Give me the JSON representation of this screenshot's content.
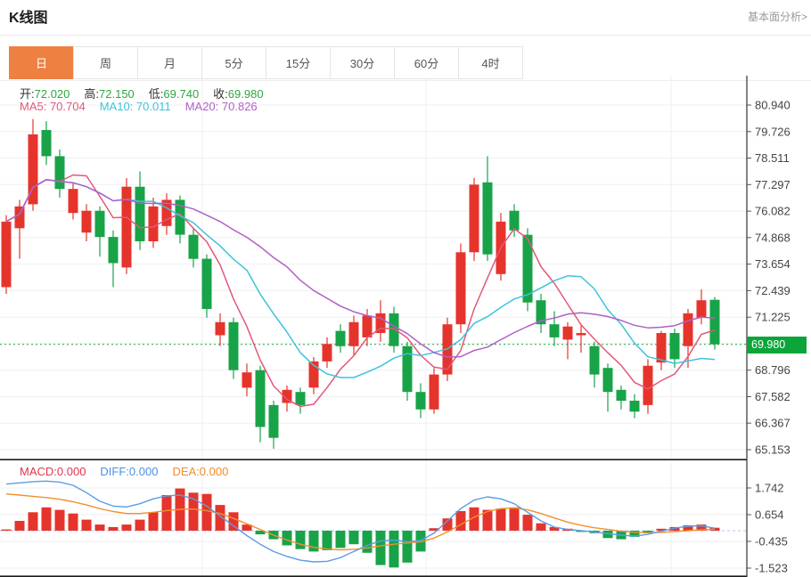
{
  "header": {
    "title": "K线图",
    "link_label": "基本面分析>"
  },
  "tabs": {
    "items": [
      "日",
      "周",
      "月",
      "5分",
      "15分",
      "30分",
      "60分",
      "4时"
    ],
    "selected": "日"
  },
  "ohlc": {
    "open_label": "开:",
    "open": "72.020",
    "high_label": "高:",
    "high": "72.150",
    "low_label": "低:",
    "low": "69.740",
    "close_label": "收:",
    "close": "69.980"
  },
  "ma": {
    "ma5": "MA5: 70.704",
    "ma10": "MA10: 70.011",
    "ma20": "MA20: 70.826"
  },
  "macd_labels": {
    "macd": "MACD:0.000",
    "diff": "DIFF:0.000",
    "dea": "DEA:0.000"
  },
  "colors": {
    "up": "#e5342c",
    "down": "#18a348",
    "ma5": "#e25878",
    "ma10": "#3ec3dc",
    "ma20": "#b05fc8",
    "diff": "#5c9ce6",
    "dea": "#f0912c",
    "accent_tab": "#ee8142",
    "badge_green": "#0ca53a",
    "value_green": "#2ba83e",
    "axis_text": "#444444",
    "grid": "#efefef",
    "current_line": "#1fa83c"
  },
  "chart_data": {
    "type": "candlestick+macd",
    "title": "K线图",
    "price_axis": {
      "ticks": [
        80.94,
        79.726,
        78.511,
        77.297,
        76.082,
        74.868,
        73.654,
        72.439,
        71.225,
        70.011,
        68.796,
        67.582,
        66.367,
        65.153
      ],
      "tick_labels": [
        "80.940",
        "79.726",
        "78.511",
        "77.297",
        "76.082",
        "74.868",
        "73.654",
        "72.439",
        "71.225",
        "70.011",
        "68.796",
        "67.582",
        "66.367",
        "65.153"
      ],
      "hidden_tick_index": 9,
      "current_price": 69.98,
      "current_price_label": "69.980"
    },
    "candles_format": [
      "open",
      "high",
      "low",
      "close"
    ],
    "candles": [
      [
        72.6,
        75.9,
        72.3,
        75.6
      ],
      [
        75.3,
        76.6,
        73.9,
        76.3
      ],
      [
        76.4,
        80.3,
        76.1,
        79.6
      ],
      [
        79.8,
        80.2,
        78.2,
        78.6
      ],
      [
        78.6,
        78.9,
        76.7,
        77.1
      ],
      [
        76.0,
        77.4,
        75.7,
        77.1
      ],
      [
        75.1,
        76.4,
        74.7,
        76.1
      ],
      [
        76.1,
        76.3,
        74.0,
        74.9
      ],
      [
        74.9,
        75.2,
        72.6,
        73.7
      ],
      [
        73.5,
        77.6,
        73.2,
        77.2
      ],
      [
        77.2,
        77.9,
        74.3,
        74.7
      ],
      [
        74.7,
        76.7,
        74.4,
        76.3
      ],
      [
        75.4,
        76.9,
        75.0,
        76.6
      ],
      [
        76.6,
        76.8,
        74.6,
        75.0
      ],
      [
        75.0,
        75.3,
        73.5,
        73.9
      ],
      [
        73.9,
        74.1,
        71.2,
        71.6
      ],
      [
        70.4,
        71.4,
        69.9,
        71.0
      ],
      [
        71.0,
        71.2,
        68.4,
        68.8
      ],
      [
        68.0,
        69.1,
        67.6,
        68.7
      ],
      [
        68.8,
        69.0,
        65.5,
        66.2
      ],
      [
        67.2,
        67.4,
        65.2,
        65.7
      ],
      [
        67.3,
        68.1,
        66.9,
        67.9
      ],
      [
        67.8,
        68.0,
        66.8,
        67.2
      ],
      [
        68.0,
        69.4,
        67.7,
        69.2
      ],
      [
        69.2,
        70.3,
        68.9,
        70.0
      ],
      [
        70.6,
        70.9,
        69.6,
        69.9
      ],
      [
        69.9,
        71.3,
        69.5,
        71.0
      ],
      [
        70.3,
        71.6,
        69.9,
        71.3
      ],
      [
        70.5,
        72.0,
        70.1,
        71.4
      ],
      [
        71.4,
        71.7,
        69.6,
        69.9
      ],
      [
        69.9,
        70.1,
        67.4,
        67.8
      ],
      [
        67.8,
        68.2,
        66.6,
        67.0
      ],
      [
        67.0,
        68.9,
        66.8,
        68.6
      ],
      [
        68.6,
        71.2,
        68.3,
        70.9
      ],
      [
        70.9,
        74.6,
        70.5,
        74.2
      ],
      [
        74.2,
        77.6,
        73.8,
        77.3
      ],
      [
        77.4,
        78.6,
        73.8,
        74.1
      ],
      [
        73.2,
        76.0,
        72.9,
        75.6
      ],
      [
        76.1,
        76.4,
        74.9,
        75.2
      ],
      [
        75.0,
        75.3,
        71.5,
        71.9
      ],
      [
        72.0,
        72.3,
        70.5,
        70.9
      ],
      [
        70.9,
        71.5,
        69.9,
        70.3
      ],
      [
        70.2,
        71.0,
        69.3,
        70.8
      ],
      [
        70.4,
        70.9,
        69.6,
        70.5
      ],
      [
        69.9,
        70.1,
        68.0,
        68.6
      ],
      [
        68.9,
        69.1,
        66.9,
        67.8
      ],
      [
        67.9,
        68.1,
        67.0,
        67.4
      ],
      [
        67.4,
        67.7,
        66.6,
        66.9
      ],
      [
        67.2,
        69.3,
        66.8,
        69.0
      ],
      [
        69.15,
        70.6,
        68.8,
        70.5
      ],
      [
        70.5,
        70.7,
        68.9,
        69.3
      ],
      [
        69.9,
        71.6,
        68.9,
        71.4
      ],
      [
        71.2,
        72.5,
        70.9,
        72.0
      ],
      [
        72.02,
        72.15,
        69.74,
        69.98
      ]
    ],
    "ma_periods": [
      5,
      10,
      20
    ],
    "macd": {
      "ticks": [
        1.742,
        0.654,
        -0.435,
        -1.523
      ],
      "tick_labels": [
        "1.742",
        "0.654",
        "-0.435",
        "-1.523"
      ],
      "hist": [
        0.05,
        0.4,
        0.75,
        0.95,
        0.85,
        0.7,
        0.45,
        0.25,
        0.15,
        0.25,
        0.45,
        0.75,
        1.45,
        1.72,
        1.55,
        1.5,
        1.05,
        0.75,
        0.25,
        -0.15,
        -0.35,
        -0.6,
        -0.75,
        -0.85,
        -0.8,
        -0.7,
        -0.55,
        -0.9,
        -1.4,
        -1.5,
        -1.3,
        -0.85,
        0.1,
        0.5,
        0.8,
        0.95,
        0.85,
        0.9,
        0.95,
        0.65,
        0.3,
        0.15,
        0.08,
        -0.05,
        -0.1,
        -0.3,
        -0.35,
        -0.25,
        -0.1,
        0.08,
        0.15,
        0.22,
        0.25,
        0.12
      ],
      "diff": [
        1.9,
        1.95,
        2.0,
        2.02,
        1.98,
        1.85,
        1.55,
        1.2,
        1.0,
        0.97,
        1.1,
        1.3,
        1.42,
        1.45,
        1.3,
        1.0,
        0.6,
        0.2,
        -0.2,
        -0.55,
        -0.85,
        -1.05,
        -1.2,
        -1.27,
        -1.25,
        -1.1,
        -0.85,
        -0.6,
        -0.42,
        -0.38,
        -0.45,
        -0.4,
        -0.1,
        0.4,
        0.9,
        1.25,
        1.38,
        1.3,
        1.1,
        0.75,
        0.4,
        0.15,
        0.05,
        0.0,
        -0.05,
        -0.12,
        -0.18,
        -0.22,
        -0.15,
        -0.02,
        0.1,
        0.18,
        0.2,
        0.1
      ],
      "dea": [
        1.5,
        1.45,
        1.4,
        1.35,
        1.28,
        1.18,
        1.05,
        0.9,
        0.78,
        0.7,
        0.7,
        0.75,
        0.82,
        0.87,
        0.88,
        0.82,
        0.7,
        0.5,
        0.28,
        0.05,
        -0.18,
        -0.38,
        -0.55,
        -0.68,
        -0.75,
        -0.78,
        -0.76,
        -0.7,
        -0.62,
        -0.55,
        -0.5,
        -0.45,
        -0.3,
        -0.05,
        0.25,
        0.55,
        0.78,
        0.9,
        0.92,
        0.85,
        0.7,
        0.52,
        0.35,
        0.22,
        0.12,
        0.05,
        -0.02,
        -0.06,
        -0.08,
        -0.07,
        -0.04,
        0.0,
        0.04,
        0.06
      ]
    }
  }
}
